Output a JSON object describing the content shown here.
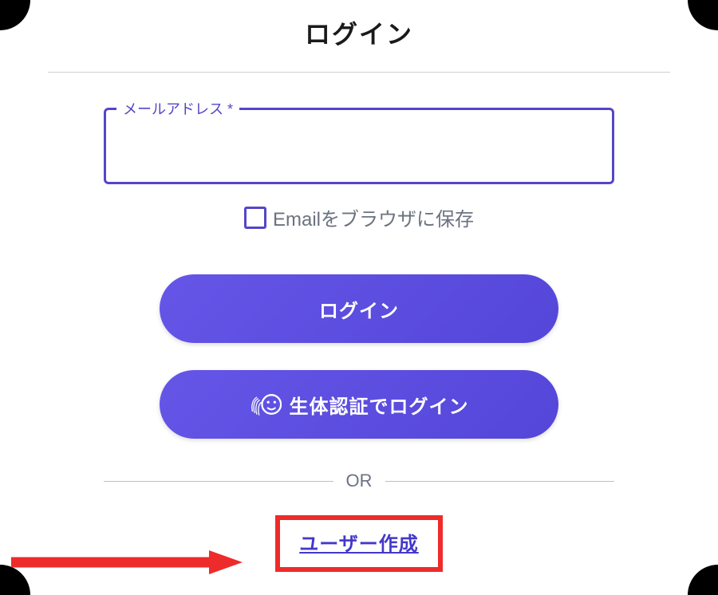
{
  "header": {
    "title": "ログイン"
  },
  "form": {
    "email_label": "メールアドレス *",
    "email_value": "",
    "save_email_label": "Emailをブラウザに保存"
  },
  "buttons": {
    "login_label": "ログイン",
    "biometric_label": "生体認証でログイン"
  },
  "divider": {
    "or_text": "OR"
  },
  "links": {
    "create_user_label": "ユーザー作成"
  },
  "colors": {
    "primary": "#5446c8",
    "highlight": "#ee2b2b"
  }
}
